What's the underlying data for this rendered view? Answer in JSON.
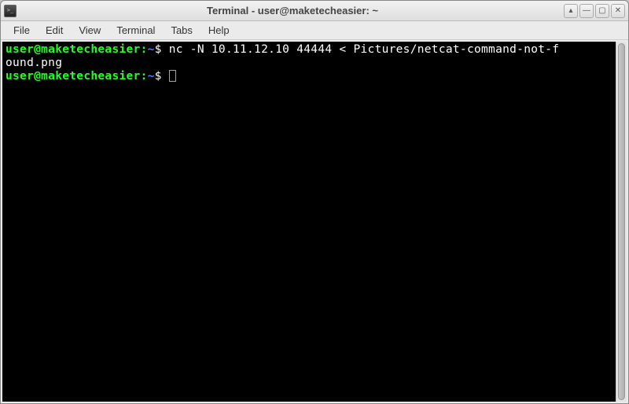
{
  "window": {
    "title": "Terminal - user@maketecheasier: ~"
  },
  "menu": {
    "items": [
      "File",
      "Edit",
      "View",
      "Terminal",
      "Tabs",
      "Help"
    ]
  },
  "terminal": {
    "prompt": {
      "user": "user",
      "at": "@",
      "host": "maketecheasier",
      "colon": ":",
      "path": "~",
      "dollar": "$ "
    },
    "lines": [
      {
        "command_part1": "nc -N 10.11.12.10 44444 < Pictures/netcat-command-not-f",
        "command_part2": "ound.png"
      }
    ]
  },
  "window_controls": {
    "up": "▴",
    "min": "—",
    "max": "▢",
    "close": "✕"
  }
}
